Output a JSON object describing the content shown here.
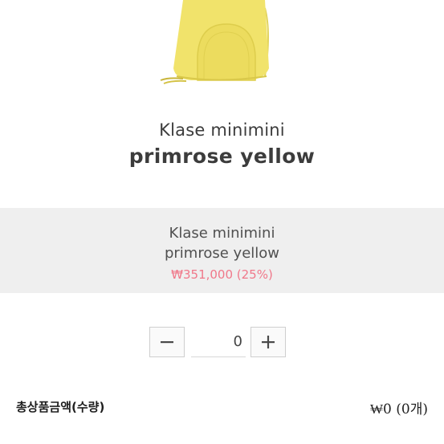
{
  "product": {
    "title_line1": "Klase minimini",
    "title_line2": "primrose yellow",
    "image_color": "#f2e36a"
  },
  "option": {
    "name": "Klase minimini",
    "color": "primrose yellow",
    "price": "₩351,000 (25%)",
    "price_color": "#f0788a"
  },
  "quantity": {
    "value": "0",
    "decrease_icon": "minus-icon",
    "increase_icon": "plus-icon"
  },
  "total": {
    "label": "총상품금액(수량)",
    "value": "₩0 (0개)"
  }
}
